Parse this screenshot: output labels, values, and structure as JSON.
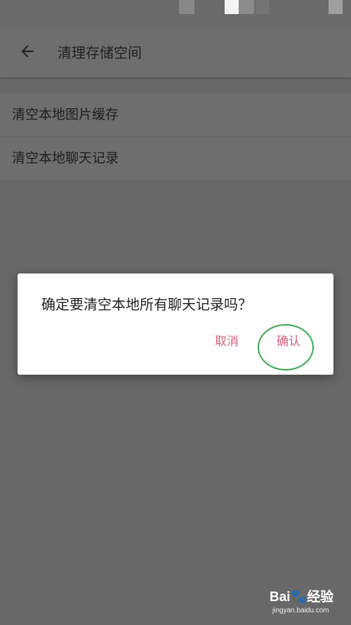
{
  "app_bar": {
    "title": "清理存储空间",
    "back_icon": "arrow-left-icon"
  },
  "list": {
    "items": [
      {
        "label": "清空本地图片缓存"
      },
      {
        "label": "清空本地聊天记录"
      }
    ]
  },
  "dialog": {
    "message": "确定要清空本地所有聊天记录吗？",
    "cancel_label": "取消",
    "confirm_label": "确认"
  },
  "watermark": {
    "brand": "Bai",
    "paw": "🐾",
    "brand_suffix": "经验",
    "url": "jingyan.baidu.com"
  },
  "colors": {
    "dim_background": "#686868",
    "dialog_button": "#d3607f",
    "highlight_ring": "#3aa84f"
  }
}
